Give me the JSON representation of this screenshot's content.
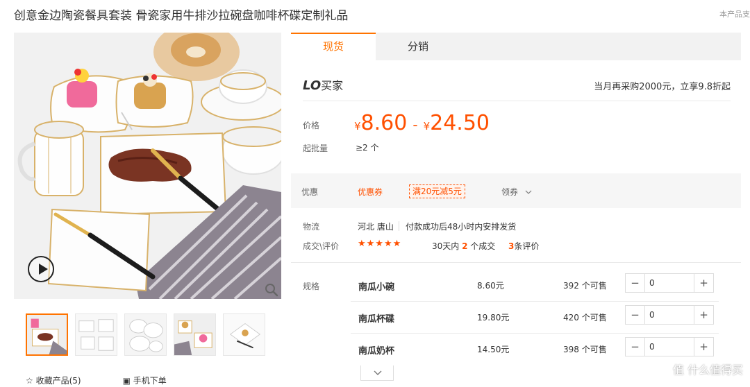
{
  "product": {
    "title": "创意金边陶瓷餐具套装 骨瓷家用牛排沙拉碗盘咖啡杯碟定制礼品",
    "corner_note": "本产品支"
  },
  "tabs": [
    {
      "label": "现货",
      "active": true
    },
    {
      "label": "分销",
      "active": false
    }
  ],
  "buyer": {
    "logo_prefix": "LO",
    "logo_text": "买家",
    "tip": "当月再采购2000元，立享9.8折起"
  },
  "price": {
    "label": "价格",
    "currency": "¥",
    "min": "8.60",
    "separator": "-",
    "max": "24.50"
  },
  "moq": {
    "label": "起批量",
    "value": "≥2 个"
  },
  "promo": {
    "label": "优惠",
    "coupon_label": "优惠券",
    "coupon_tag": "满20元减5元",
    "get_label": "领券"
  },
  "logistics": {
    "label": "物流",
    "origin": "河北 唐山",
    "shipping": "付款成功后48小时内安排发货"
  },
  "reviews": {
    "label": "成交\\评价",
    "stars": "★★★★★",
    "deals_prefix": "30天内",
    "deals_count": "2",
    "deals_suffix": "个成交",
    "review_count": "3",
    "review_suffix": "条评价"
  },
  "specs": {
    "label": "规格",
    "items": [
      {
        "name": "南瓜小碗",
        "price": "8.60元",
        "stock": "392 个可售",
        "qty": "0"
      },
      {
        "name": "南瓜杯碟",
        "price": "19.80元",
        "stock": "420 个可售",
        "qty": "0"
      },
      {
        "name": "南瓜奶杯",
        "price": "14.50元",
        "stock": "398 个可售",
        "qty": "0"
      }
    ],
    "minus": "−",
    "plus": "+"
  },
  "bottom_links": {
    "favorite": "☆ 收藏产品(5)",
    "mobile_order": "▣ 手机下单"
  },
  "watermark": "值 什么值得买",
  "colors": {
    "accent": "#ff7300",
    "price": "#ff5000"
  }
}
